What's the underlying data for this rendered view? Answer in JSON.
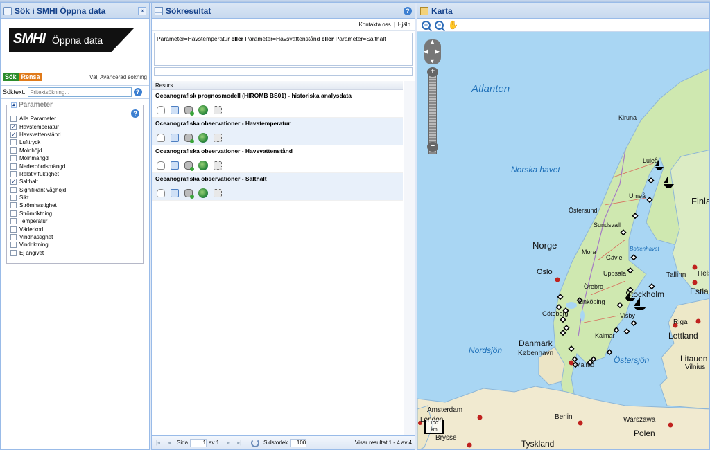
{
  "left": {
    "title": "Sök i SMHI Öppna data",
    "collapse": "«",
    "logo": {
      "smhi": "SMHI",
      "text": "Öppna data"
    },
    "search_btn": "Sök",
    "clear_btn": "Rensa",
    "advanced": "Välj Avancerad sökning",
    "search_label": "Söktext:",
    "search_placeholder": "Fritextsökning...",
    "help": "?",
    "fieldset_title": "Parameter",
    "params": [
      {
        "label": "Alla Parameter",
        "checked": false
      },
      {
        "label": "Havstemperatur",
        "checked": true
      },
      {
        "label": "Havsvattenstånd",
        "checked": true
      },
      {
        "label": "Lufttryck",
        "checked": false
      },
      {
        "label": "Molnhöjd",
        "checked": false
      },
      {
        "label": "Molnmängd",
        "checked": false
      },
      {
        "label": "Nederbördsmängd",
        "checked": false
      },
      {
        "label": "Relativ fuktighet",
        "checked": false
      },
      {
        "label": "Salthalt",
        "checked": true
      },
      {
        "label": "Signifikant våghöjd",
        "checked": false
      },
      {
        "label": "Sikt",
        "checked": false
      },
      {
        "label": "Strömhastighet",
        "checked": false
      },
      {
        "label": "Strömriktning",
        "checked": false
      },
      {
        "label": "Temperatur",
        "checked": false
      },
      {
        "label": "Väderkod",
        "checked": false
      },
      {
        "label": "Vindhastighet",
        "checked": false
      },
      {
        "label": "Vindriktning",
        "checked": false
      },
      {
        "label": "Ej angivet",
        "checked": false
      }
    ]
  },
  "mid": {
    "title": "Sökresultat",
    "help": "?",
    "contact": "Kontakta oss",
    "helplink": "Hjälp",
    "query": {
      "p1": "Parameter=Havstemperatur",
      "op1": "eller",
      "p2": "Parameter=Havsvattenstånd",
      "op2": "eller",
      "p3": "Parameter=Salthalt"
    },
    "column_header": "Resurs",
    "results": [
      {
        "title": "Oceanografisk prognosmodell (HIROMB BS01) - historiska analysdata"
      },
      {
        "title": "Oceanografiska observationer - Havstemperatur"
      },
      {
        "title": "Oceanografiska observationer - Havsvattenstånd"
      },
      {
        "title": "Oceanografiska observationer - Salthalt"
      }
    ],
    "pager": {
      "page_label": "Sida",
      "page": "1",
      "of": "av 1",
      "size_label": "Sidstorlek",
      "size": "100",
      "info": "Visar resultat 1 - 4 av 4"
    }
  },
  "map": {
    "title": "Karta",
    "scale": {
      "value": "100",
      "unit": "km"
    },
    "labels": [
      {
        "text": "Atlanten",
        "kind": "sea"
      },
      {
        "text": "Norska havet",
        "kind": "sea"
      },
      {
        "text": "Nordsjön",
        "kind": "sea"
      },
      {
        "text": "Bottenhavet",
        "kind": "sea"
      },
      {
        "text": "Östersjön",
        "kind": "sea"
      },
      {
        "text": "Kiruna",
        "kind": "city"
      },
      {
        "text": "Luleå",
        "kind": "city"
      },
      {
        "text": "Umeå",
        "kind": "city"
      },
      {
        "text": "Östersund",
        "kind": "city"
      },
      {
        "text": "Sundsvall",
        "kind": "city"
      },
      {
        "text": "Mora",
        "kind": "city"
      },
      {
        "text": "Gävle",
        "kind": "city"
      },
      {
        "text": "Uppsala",
        "kind": "city"
      },
      {
        "text": "Örebro",
        "kind": "city"
      },
      {
        "text": "Stockholm",
        "kind": "capital"
      },
      {
        "text": "Linköping",
        "kind": "city"
      },
      {
        "text": "Göteborg",
        "kind": "city"
      },
      {
        "text": "Visby",
        "kind": "city"
      },
      {
        "text": "Kalmar",
        "kind": "city"
      },
      {
        "text": "Malmö",
        "kind": "city"
      },
      {
        "text": "Oslo",
        "kind": "capital"
      },
      {
        "text": "Norge",
        "kind": "country"
      },
      {
        "text": "Finland",
        "kind": "country"
      },
      {
        "text": "Danmark",
        "kind": "country"
      },
      {
        "text": "København",
        "kind": "capital"
      },
      {
        "text": "Tallinn",
        "kind": "capital"
      },
      {
        "text": "Helsi",
        "kind": "capital"
      },
      {
        "text": "Estla",
        "kind": "country"
      },
      {
        "text": "Riga",
        "kind": "capital"
      },
      {
        "text": "Lettland",
        "kind": "country"
      },
      {
        "text": "Litauen",
        "kind": "country"
      },
      {
        "text": "Vilnius",
        "kind": "capital"
      },
      {
        "text": "Amsterdam",
        "kind": "capital"
      },
      {
        "text": "London",
        "kind": "capital"
      },
      {
        "text": "Brysse",
        "kind": "capital"
      },
      {
        "text": "Berlin",
        "kind": "capital"
      },
      {
        "text": "Warszawa",
        "kind": "capital"
      },
      {
        "text": "Polen",
        "kind": "country"
      },
      {
        "text": "Tyskland",
        "kind": "country"
      }
    ]
  },
  "colors": {
    "header_text": "#15428b",
    "sea": "#a9d6f3",
    "land": "#cfe8b0",
    "border": "#99bbe8"
  }
}
